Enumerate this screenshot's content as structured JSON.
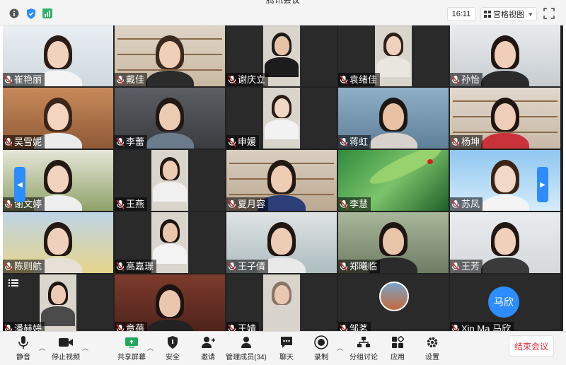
{
  "window": {
    "title": "腾讯会议"
  },
  "topbar": {
    "time": "16:11",
    "view_label": "宫格视图",
    "icons": [
      "info-icon",
      "shield-icon",
      "signal-icon",
      "fullscreen-icon"
    ]
  },
  "participants": [
    {
      "name": "崔艳丽"
    },
    {
      "name": "戴佳"
    },
    {
      "name": "谢庆立"
    },
    {
      "name": "袁绪佳"
    },
    {
      "name": "孙怡"
    },
    {
      "name": "吴雪妮"
    },
    {
      "name": "李蕾"
    },
    {
      "name": "申媛"
    },
    {
      "name": "蒋虹"
    },
    {
      "name": "杨坤"
    },
    {
      "name": "谢文婷"
    },
    {
      "name": "王燕"
    },
    {
      "name": "夏月容"
    },
    {
      "name": "李慧"
    },
    {
      "name": "苏凤"
    },
    {
      "name": "陈则航"
    },
    {
      "name": "高嘉璟"
    },
    {
      "name": "王子倩"
    },
    {
      "name": "郑曦临"
    },
    {
      "name": "王芳"
    },
    {
      "name": "潘赫婷"
    },
    {
      "name": "章蓓"
    },
    {
      "name": "王婧"
    },
    {
      "name": "邹茗"
    },
    {
      "name": "Xin Ma 马欣"
    }
  ],
  "avatar_initial": "马欣",
  "toolbar": {
    "mute": "静音",
    "stop_video": "停止视频",
    "share_screen": "共享屏幕",
    "security": "安全",
    "invite": "邀请",
    "manage_members": "管理成员(34)",
    "chat": "聊天",
    "record": "录制",
    "breakout": "分组讨论",
    "apps": "应用",
    "settings": "设置",
    "end_meeting": "结束会议"
  },
  "colors": {
    "accent": "#2d8cff",
    "end_text": "#e0303b",
    "grid_bg": "#222222"
  }
}
